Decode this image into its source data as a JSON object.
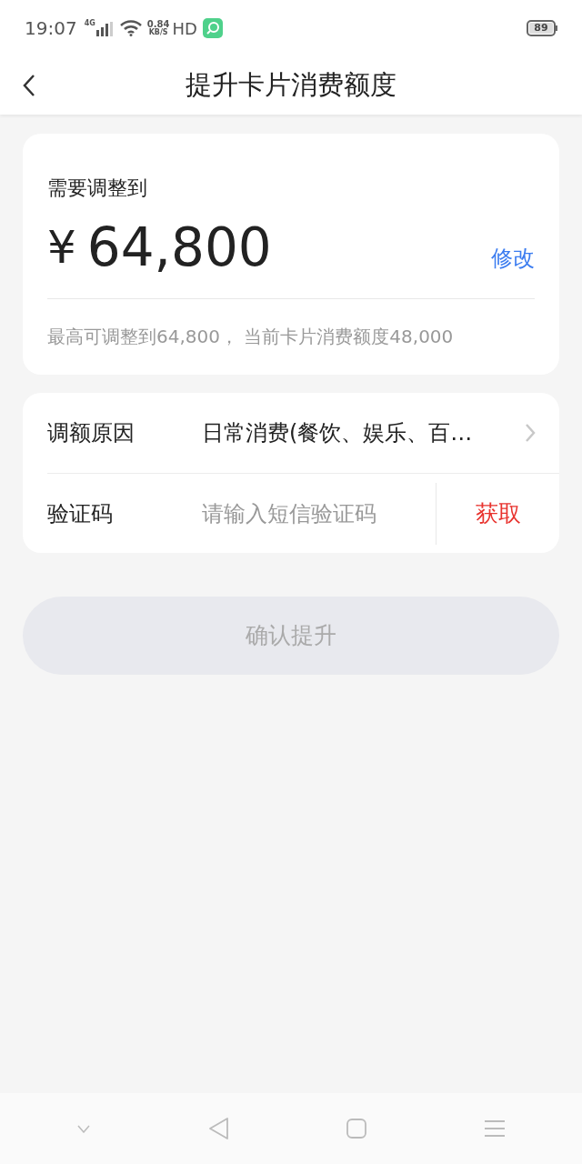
{
  "status_bar": {
    "time": "19:07",
    "network": "4G",
    "speed_value": "0.84",
    "speed_unit": "KB/S",
    "hd": "HD",
    "battery": "89"
  },
  "header": {
    "title": "提升卡片消费额度"
  },
  "amount_card": {
    "label": "需要调整到",
    "currency": "¥",
    "amount": "64,800",
    "edit": "修改",
    "note": "最高可调整到64,800， 当前卡片消费额度48,000"
  },
  "form": [
    {
      "kind": "select",
      "label": "调额原因",
      "value": "日常消费(餐饮、娱乐、百…"
    },
    {
      "kind": "code",
      "label": "验证码",
      "placeholder": "请输入短信验证码",
      "action": "获取"
    }
  ],
  "confirm": {
    "label": "确认提升",
    "disabled": true
  }
}
